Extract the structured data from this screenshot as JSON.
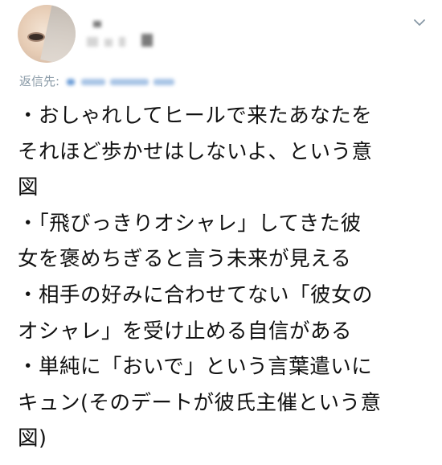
{
  "tweet": {
    "reply_label": "返信先:",
    "reply_handle_visible": "_yan さん",
    "lines": [
      "・おしゃれしてヒールで来たあなたを",
      "それほど歩かせはしないよ、という意",
      "図",
      "・「飛びっきりオシャレ」してきた彼",
      "女を褒めちぎると言う未来が見える",
      "・相手の好みに合わせてない「彼女の",
      "オシャレ」を受け止める自信がある",
      "・単純に「おいで」という言葉遣いに",
      "キュン(そのデートが彼氏主催という意",
      "図)"
    ],
    "icons": {
      "avatar": "avatar",
      "menu": "chevron-down-icon"
    },
    "colors": {
      "text": "#111111",
      "secondary": "#8899a6",
      "link": "#1da1f2"
    }
  }
}
